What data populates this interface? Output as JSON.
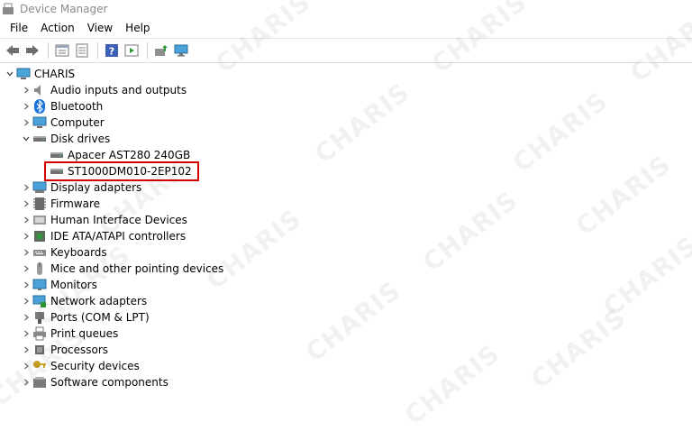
{
  "window": {
    "title": "Device Manager"
  },
  "menu": [
    "File",
    "Action",
    "View",
    "Help"
  ],
  "toolbar": {
    "buttons": [
      "back-arrow-icon",
      "forward-arrow-icon",
      "properties-icon",
      "refresh-list-icon",
      "help-icon",
      "run-icon",
      "update-driver-icon",
      "scan-monitor-icon"
    ]
  },
  "tree": {
    "root": "CHARIS",
    "nodes": [
      {
        "label": "Audio inputs and outputs",
        "icon": "speaker-icon"
      },
      {
        "label": "Bluetooth",
        "icon": "bluetooth-icon"
      },
      {
        "label": "Computer",
        "icon": "computer-icon"
      },
      {
        "label": "Disk drives",
        "icon": "disk-drive-icon",
        "children": [
          {
            "label": "Apacer AST280 240GB",
            "icon": "disk-drive-icon"
          },
          {
            "label": "ST1000DM010-2EP102",
            "icon": "disk-drive-icon",
            "highlighted": true
          }
        ]
      },
      {
        "label": "Display adapters",
        "icon": "display-adapter-icon"
      },
      {
        "label": "Firmware",
        "icon": "firmware-icon"
      },
      {
        "label": "Human Interface Devices",
        "icon": "hid-icon"
      },
      {
        "label": "IDE ATA/ATAPI controllers",
        "icon": "ide-controller-icon"
      },
      {
        "label": "Keyboards",
        "icon": "keyboard-icon"
      },
      {
        "label": "Mice and other pointing devices",
        "icon": "mouse-icon"
      },
      {
        "label": "Monitors",
        "icon": "monitor-icon"
      },
      {
        "label": "Network adapters",
        "icon": "network-icon"
      },
      {
        "label": "Ports (COM & LPT)",
        "icon": "port-icon"
      },
      {
        "label": "Print queues",
        "icon": "printer-icon"
      },
      {
        "label": "Processors",
        "icon": "processor-icon"
      },
      {
        "label": "Security devices",
        "icon": "security-key-icon"
      },
      {
        "label": "Software components",
        "icon": "software-component-icon"
      }
    ]
  },
  "highlight_color": "#d60000",
  "watermark": "CHARIS"
}
